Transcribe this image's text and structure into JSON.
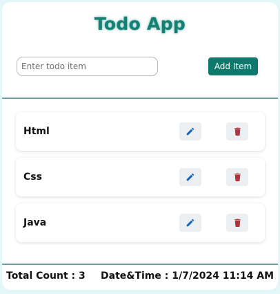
{
  "app": {
    "title": "Todo App"
  },
  "form": {
    "input_value": "",
    "input_placeholder": "Enter todo item",
    "add_button_label": "Add Item"
  },
  "todos": [
    {
      "label": "Html"
    },
    {
      "label": "Css"
    },
    {
      "label": "Java"
    }
  ],
  "footer": {
    "total_count_text": "Total Count : 3",
    "datetime_text": "Date&Time : 1/7/2024 11:14 AM"
  },
  "colors": {
    "accent": "#10796d",
    "title": "#138275",
    "edit_icon": "#1565c0",
    "delete_icon": "#b0343f",
    "icon_button_bg": "#eceff1",
    "divider": "#6e9e9f",
    "page_background": "#e3f6f8"
  },
  "icons": {
    "edit": "pencil-icon",
    "delete": "trash-icon"
  }
}
